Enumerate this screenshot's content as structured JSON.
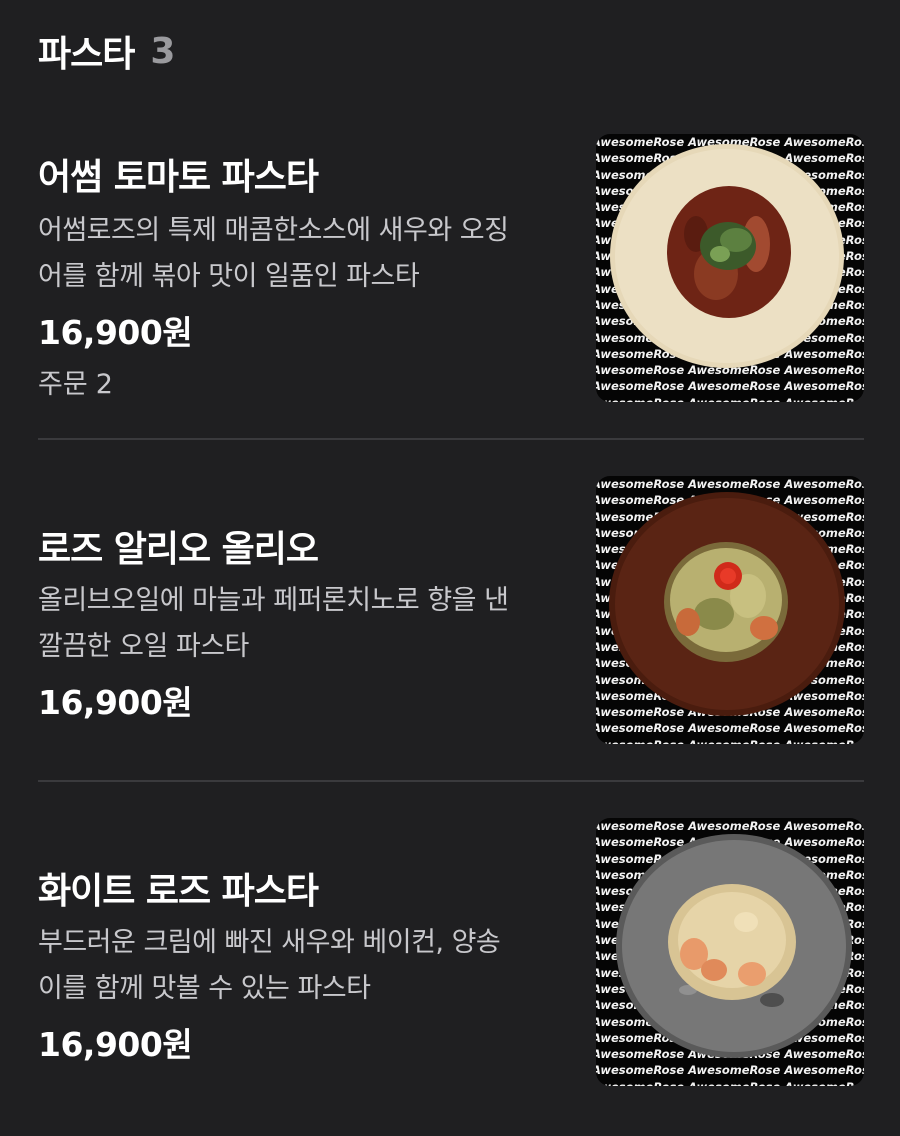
{
  "section": {
    "title": "파스타",
    "count": "3"
  },
  "watermark_text": "AwesomeRose AwesomeRose AwesomeRose",
  "items": [
    {
      "name": "어썸 토마토 파스타",
      "desc_line1": "어썸로즈의 특제 매콤한소스에 새우와 오징",
      "desc_line2": "어를 함께 볶아 맛이 일품인 파스타",
      "price": "16,900원",
      "order_label": "주문",
      "order_count": "2",
      "plate_color": "#e6d8b8",
      "food_color": "#6e2415"
    },
    {
      "name": "로즈 알리오 올리오",
      "desc_line1": "올리브오일에 마늘과 페퍼론치노로 향을 낸",
      "desc_line2": "깔끔한 오일 파스타",
      "price": "16,900원",
      "plate_color": "#4a1c0e",
      "food_color": "#b8b070"
    },
    {
      "name": "화이트 로즈 파스타",
      "desc_line1": "부드러운 크림에 빠진 새우와 베이컨, 양송",
      "desc_line2": "이를 함께 맛볼 수 있는 파스타",
      "price": "16,900원",
      "plate_color": "#6a6a6a",
      "food_color": "#e6d4a8"
    }
  ],
  "colors": {
    "background": "#1f1f21",
    "divider": "#3a3a3d",
    "text_primary": "#ffffff",
    "text_secondary": "#c8c8cc",
    "count_gray": "#9a9a9e"
  }
}
